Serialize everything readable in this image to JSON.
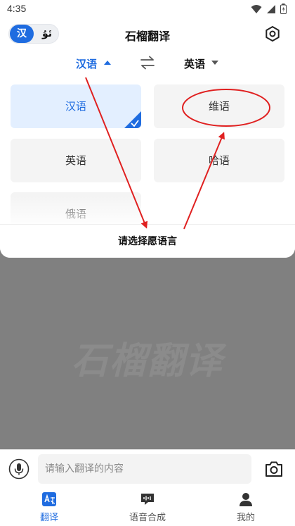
{
  "status_bar": {
    "time": "4:35"
  },
  "header": {
    "title": "石榴翻译",
    "lang_toggle": {
      "active": "汉",
      "other": "ئۇ"
    }
  },
  "lang_selector": {
    "source": "汉语",
    "target": "英语"
  },
  "languages": [
    {
      "label": "汉语",
      "selected": true
    },
    {
      "label": "维语",
      "selected": false
    },
    {
      "label": "英语",
      "selected": false
    },
    {
      "label": "哈语",
      "selected": false
    },
    {
      "label": "俄语",
      "selected": false
    }
  ],
  "sheet": {
    "title": "请选择愿语言"
  },
  "watermark": "石榴翻译",
  "input": {
    "placeholder": "请输入翻译的内容"
  },
  "bottom_nav": [
    {
      "label": "翻译",
      "active": true
    },
    {
      "label": "语音合成",
      "active": false
    },
    {
      "label": "我的",
      "active": false
    }
  ],
  "colors": {
    "accent": "#1f6ce0",
    "annotation": "#e02020",
    "overlay": "#808080"
  }
}
